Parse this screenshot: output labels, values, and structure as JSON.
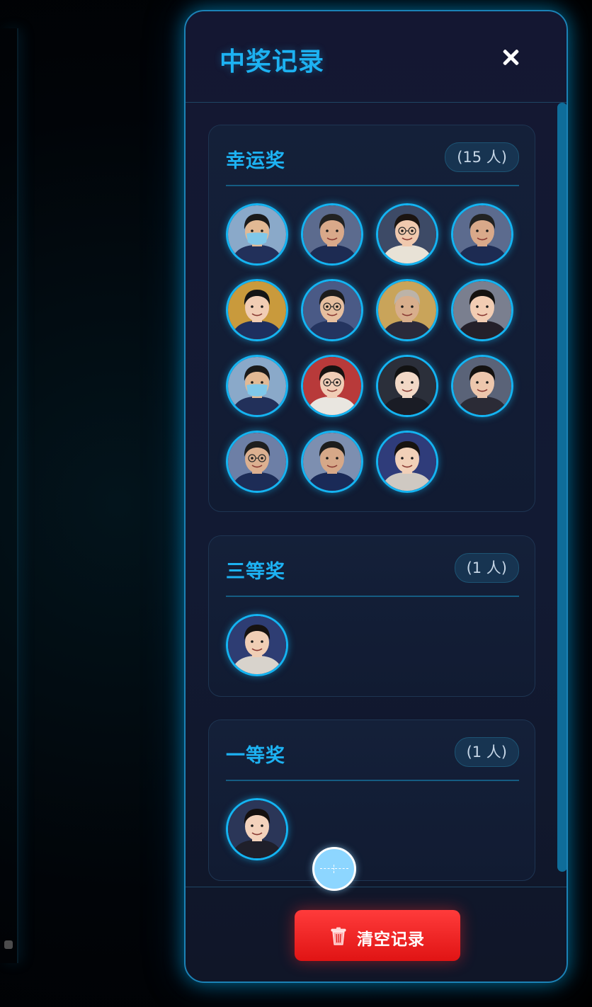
{
  "dialog": {
    "title": "中奖记录",
    "close_icon": "close-icon"
  },
  "groups": [
    {
      "name": "幸运奖",
      "count": "(15 人)",
      "winners": [
        {
          "photo": "winner-photo",
          "bg": "#8aa9c9",
          "skin": "#e2b994",
          "hair": "#1a1a1a",
          "shirt": "#22305a",
          "accessory": "mask"
        },
        {
          "photo": "winner-photo",
          "bg": "#5c6b8e",
          "skin": "#d9a98a",
          "hair": "#222222",
          "shirt": "#1d2b52",
          "accessory": "none"
        },
        {
          "photo": "winner-photo",
          "bg": "#3d4a66",
          "skin": "#f0c9ae",
          "hair": "#1b1410",
          "shirt": "#e8e2d6",
          "accessory": "glasses"
        },
        {
          "photo": "winner-photo",
          "bg": "#5c6b8e",
          "skin": "#d9a98a",
          "hair": "#222222",
          "shirt": "#1d2b52",
          "accessory": "none"
        },
        {
          "photo": "winner-photo",
          "bg": "#c99a3c",
          "skin": "#f1cdb4",
          "hair": "#151515",
          "shirt": "#1e2f5e",
          "accessory": "none"
        },
        {
          "photo": "winner-photo",
          "bg": "#4a5a86",
          "skin": "#e6bf9f",
          "hair": "#1c1c1c",
          "shirt": "#24345f",
          "accessory": "glasses"
        },
        {
          "photo": "winner-photo",
          "bg": "#c9a45a",
          "skin": "#d8ae8c",
          "hair": "#bcb3a8",
          "shirt": "#2a2a3a",
          "accessory": "none"
        },
        {
          "photo": "winner-photo",
          "bg": "#7a7f8f",
          "skin": "#f2cdb3",
          "hair": "#141210",
          "shirt": "#24202a",
          "accessory": "none"
        },
        {
          "photo": "winner-photo",
          "bg": "#8aa9c9",
          "skin": "#e2b994",
          "hair": "#1a1a1a",
          "shirt": "#22305a",
          "accessory": "mask"
        },
        {
          "photo": "winner-photo",
          "bg": "#b83a3a",
          "skin": "#f0cdb6",
          "hair": "#171312",
          "shirt": "#e9e6e0",
          "accessory": "glasses"
        },
        {
          "photo": "winner-photo",
          "bg": "#2b2f3a",
          "skin": "#f2d8c6",
          "hair": "#121212",
          "shirt": "#1a1c25",
          "accessory": "none"
        },
        {
          "photo": "winner-photo",
          "bg": "#5a6378",
          "skin": "#edc7ad",
          "hair": "#141210",
          "shirt": "#2b2b36",
          "accessory": "none"
        },
        {
          "photo": "winner-photo",
          "bg": "#6d7fa6",
          "skin": "#dcb090",
          "hair": "#1e1e1e",
          "shirt": "#1d2c56",
          "accessory": "glasses"
        },
        {
          "photo": "winner-photo",
          "bg": "#7d8fb0",
          "skin": "#d6a888",
          "hair": "#1d1d1d",
          "shirt": "#1a2a57",
          "accessory": "none"
        },
        {
          "photo": "winner-photo",
          "bg": "#2f3c7a",
          "skin": "#f1d0b8",
          "hair": "#171310",
          "shirt": "#cfc9c2",
          "accessory": "none"
        }
      ]
    },
    {
      "name": "三等奖",
      "count": "(1 人)",
      "winners": [
        {
          "photo": "winner-photo",
          "bg": "#2e3d73",
          "skin": "#f0ceb5",
          "hair": "#161210",
          "shirt": "#d8d3cc",
          "accessory": "none"
        }
      ]
    },
    {
      "name": "一等奖",
      "count": "(1 人)",
      "winners": [
        {
          "photo": "winner-photo",
          "bg": "#2b3658",
          "skin": "#f3d2bc",
          "hair": "#141010",
          "shirt": "#1f1f2a",
          "accessory": "none"
        }
      ]
    }
  ],
  "footer": {
    "clear_button_label": "清空记录",
    "clear_button_icon": "trash-icon"
  },
  "floating_handle_icon": "crosshair-icon",
  "colors": {
    "accent": "#1db2f2",
    "panel_border": "#1b82b6",
    "danger": "#e01414",
    "avatar_ring": "#14b4f2"
  }
}
